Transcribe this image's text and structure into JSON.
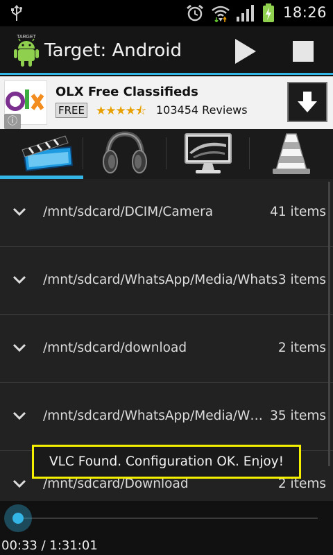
{
  "status_bar": {
    "time": "18:26"
  },
  "action_bar": {
    "icon_label": "TARGET",
    "title": "Target: Android"
  },
  "ad": {
    "logo_text": "OLX",
    "title": "OLX Free Classifieds",
    "price_badge": "FREE",
    "stars": "★★★★⯪",
    "rating": 4.5,
    "reviews": "103454 Reviews"
  },
  "tabs": [
    {
      "name": "video-tab",
      "icon": "clapperboard-icon",
      "active": true
    },
    {
      "name": "audio-tab",
      "icon": "headphones-icon",
      "active": false
    },
    {
      "name": "screen-tab",
      "icon": "monitor-icon",
      "active": false
    },
    {
      "name": "vlc-tab",
      "icon": "vlc-cone-icon",
      "active": false
    }
  ],
  "list": {
    "items": [
      {
        "path": "/mnt/sdcard/DCIM/Camera",
        "count": "41 items"
      },
      {
        "path": "/mnt/sdcard/WhatsApp/Media/Whats",
        "count": "3 items"
      },
      {
        "path": "/mnt/sdcard/download",
        "count": "2 items"
      },
      {
        "path": "/mnt/sdcard/WhatsApp/Media/WhatsApp",
        "count": "35 items"
      },
      {
        "path": "/mnt/sdcard/Download",
        "count": "2 items"
      }
    ]
  },
  "toast": {
    "text": "VLC Found. Configuration OK. Enjoy!"
  },
  "player": {
    "elapsed": "00:33",
    "total": "1:31:01",
    "time_text": "00:33 / 1:31:01",
    "progress": 0.006
  },
  "colors": {
    "accent": "#33b5e5",
    "toast_border": "#f5f000",
    "background": "#111111"
  }
}
